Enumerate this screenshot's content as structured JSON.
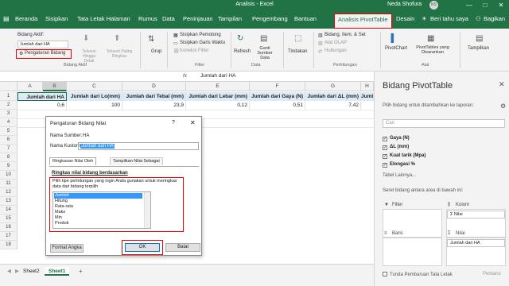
{
  "window": {
    "title": "Analisis - Excel",
    "user": "Neda Shofura",
    "user_initials": "NS",
    "minimize": "—",
    "maximize": "□",
    "close": "✕"
  },
  "tabs": [
    "Beranda",
    "Sisipkan",
    "Tata Letak Halaman",
    "Rumus",
    "Data",
    "Peninjauan",
    "Tampilan",
    "Pengembang",
    "Bantuan",
    "Analisis PivotTable",
    "Desain"
  ],
  "tell_me": "Beri tahu saya",
  "share": "Bagikan",
  "ribbon": {
    "active_field_label": "Bidang Aktif:",
    "active_field_value": "Jumlah dari HA",
    "field_settings": "Pengaturan Bidang",
    "drill_down": "Telusuri Hingga Detail",
    "drill_up": "Telusuri Paling Ringkas",
    "group_active_field": "Bidang Aktif",
    "group": "Grup",
    "insert_slicer": "Sisipkan Pemotong",
    "insert_timeline": "Sisipkan Garis Waktu",
    "filter_connections": "Koneksi Filter",
    "group_filter": "Filter",
    "refresh": "Refresh",
    "change_source": "Ganti Sumber Data",
    "group_data": "Data",
    "actions": "Tindakan",
    "fields_items_sets": "Bidang, Item, & Set",
    "olap_tools": "Alat OLAP",
    "relationships": "Hubungan",
    "group_calculations": "Perhitungan",
    "pivotchart": "PivotChart",
    "recommended": "PivotTables yang Disarankan",
    "group_tools": "Alat",
    "show": "Tampilkan"
  },
  "formula_bar": {
    "fx": "fx",
    "content": "Jumlah dari HA"
  },
  "sheet": {
    "columns": [
      "A",
      "B",
      "C",
      "D",
      "E",
      "F",
      "G",
      "H"
    ],
    "rows": [
      "1",
      "2",
      "3",
      "4",
      "5",
      "6",
      "7",
      "8",
      "9",
      "10",
      "11",
      "12",
      "13",
      "14",
      "15",
      "16",
      "17",
      "18"
    ],
    "headers": [
      "Jumlah dari HA",
      "Jumlah dari Lo(mm)",
      "Jumlah dari Tebal (mm)",
      "Jumlah dari Lebar (mm)",
      "Jumlah dari Gaya (N)",
      "Jumlah dari ΔL (mm)",
      "Jumlah"
    ],
    "values": [
      "0,6",
      "100",
      "23,9",
      "0,12",
      "0,51",
      "7,42",
      ""
    ]
  },
  "dialog": {
    "title": "Pengaturan Bidang Nilai",
    "help": "?",
    "close": "✕",
    "source_name_label": "Nama Sumber:",
    "source_name_value": "HA",
    "custom_name_label": "Nama Kustom:",
    "custom_name_value": "Jumlah dari HA",
    "tab_summarize": "Ringkasan Nilai Oleh",
    "tab_show": "Tampilkan Nilai Sebagai",
    "section": "Ringkas nilai bidang berdasarkan",
    "instruction": "Pilih tipe perhitungan yang ingin Anda gunakan untuk meringkas data dari bidang terpilih",
    "functions": [
      "Jumlah",
      "Hitung",
      "Rata-rata",
      "Maks",
      "Min",
      "Produk"
    ],
    "selected_function": "Jumlah",
    "number_format": "Format Angka",
    "ok": "OK",
    "cancel": "Batal"
  },
  "pane": {
    "title": "Bidang PivotTable",
    "close": "✕",
    "choose_fields": "Pilih bidang untuk ditambahkan ke laporan:",
    "search_placeholder": "Cari",
    "fields": [
      {
        "name": "Gaya (N)",
        "checked": true
      },
      {
        "name": "ΔL (mm)",
        "checked": true
      },
      {
        "name": "Kuat tarik (Mpa)",
        "checked": true
      },
      {
        "name": "Elongasi %",
        "checked": true
      }
    ],
    "more_tables": "Tabel Lainnya...",
    "drag_areas": "Seret bidang antara area di bawah ini:",
    "filter": "Filter",
    "columns": "Kolom",
    "columns_chip": "Σ Nilai",
    "rows": "Baris",
    "values": "Nilai",
    "values_chip": "Jumlah dari HA",
    "defer": "Tunda Pembaruan Tata Letak",
    "update": "Perbarui"
  },
  "status": {
    "sheets": [
      "Sheet2",
      "Sheet1"
    ],
    "active_sheet": "Sheet1",
    "add": "+"
  },
  "colors": {
    "excel_green": "#217346",
    "highlight_red": "#e00000",
    "selection_blue": "#3399ff"
  }
}
